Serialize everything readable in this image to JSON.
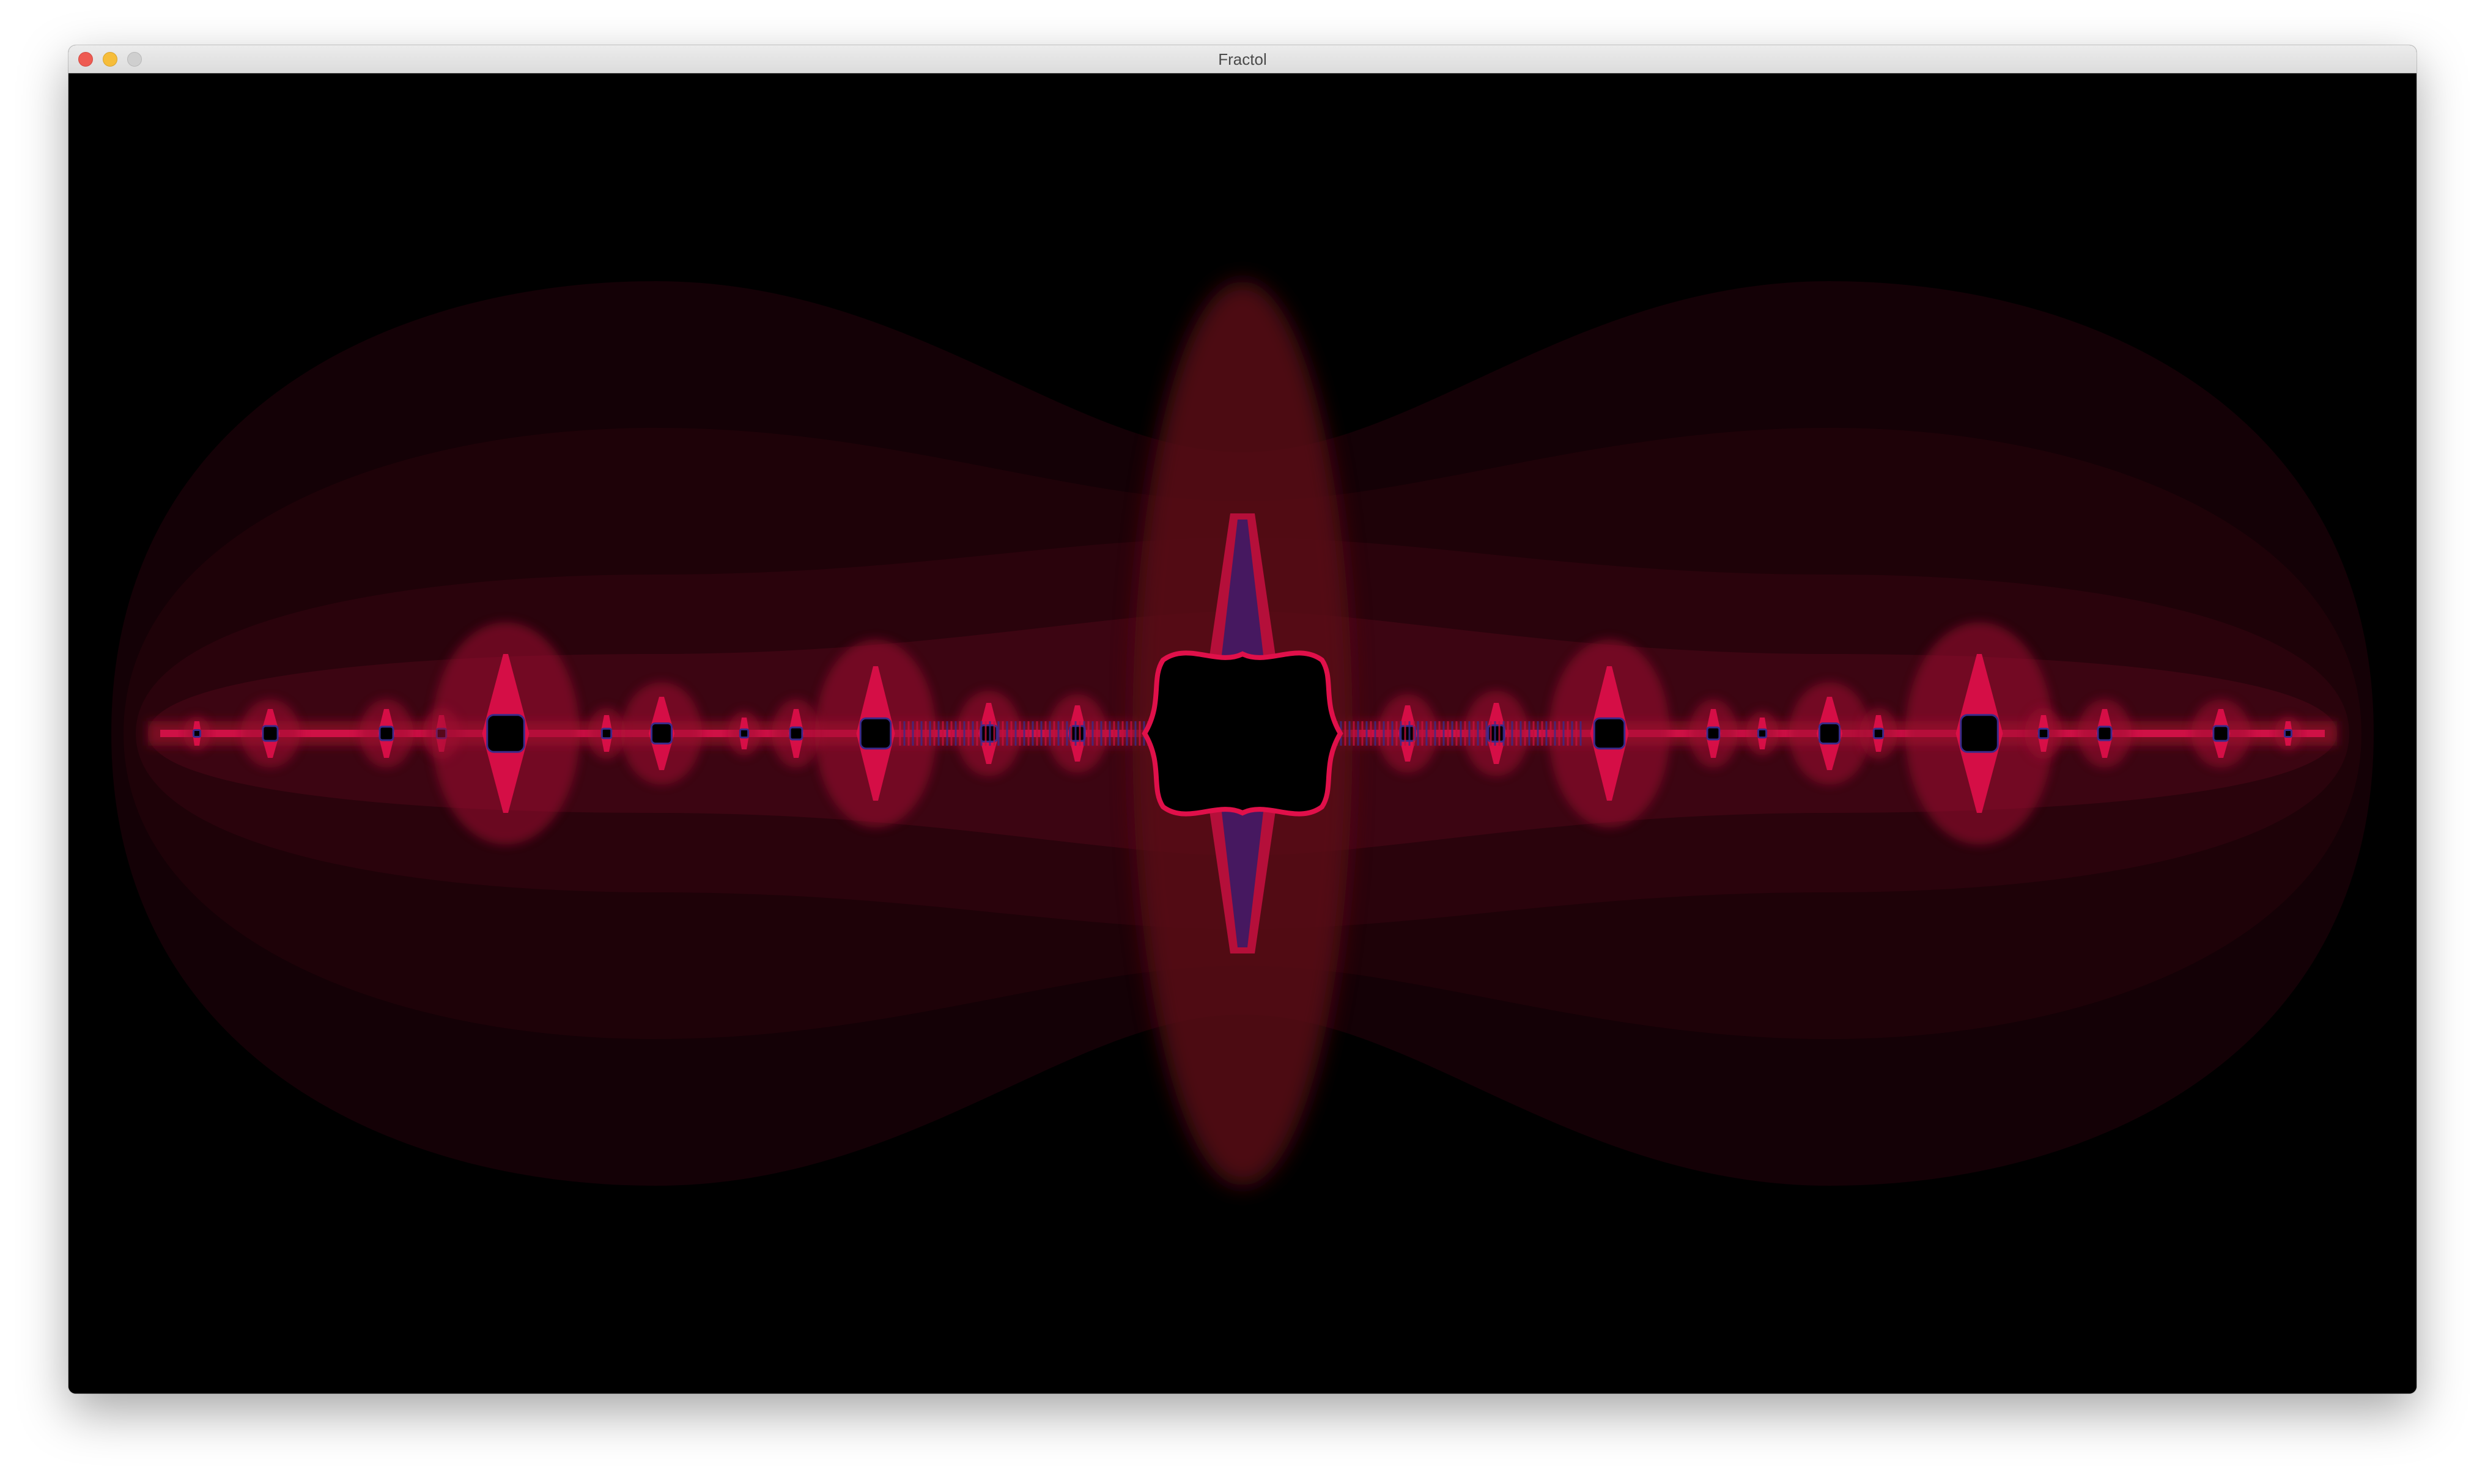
{
  "window": {
    "title": "Fractol"
  },
  "titlebar": {
    "buttons": [
      "close",
      "minimize",
      "zoom"
    ]
  },
  "render": {
    "background": "#000000",
    "glow_dark": "#1a0206",
    "glow_mid": "#5a0a18",
    "glow_bright": "#e0104a",
    "filament": "#3a2a8a"
  }
}
